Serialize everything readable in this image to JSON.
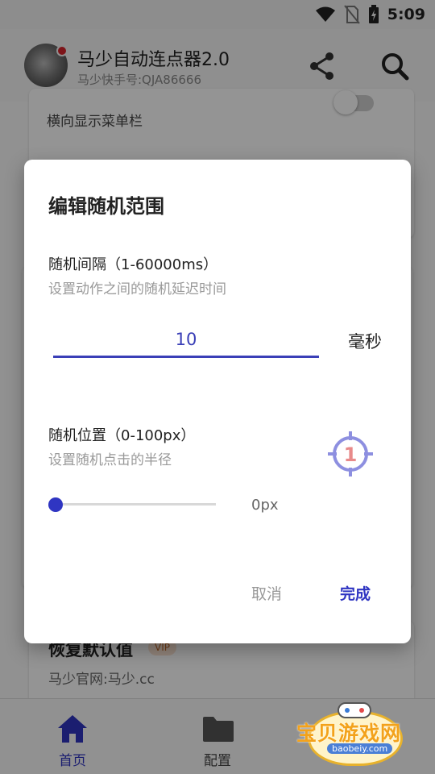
{
  "status_bar": {
    "time": "5:09",
    "icons": [
      "wifi-icon",
      "no-sim-icon",
      "battery-charging-icon"
    ]
  },
  "app_bar": {
    "title": "马少自动连点器2.0",
    "subtitle": "马少快手号:QJA86666",
    "actions": [
      "share-icon",
      "search-icon"
    ]
  },
  "background": {
    "horizontal_menu_label": "横向显示菜单栏",
    "restore_defaults_label": "恢复默认值",
    "vip_badge": "VIP",
    "official_site": "马少官网:马少.cc"
  },
  "dialog": {
    "title": "编辑随机范围",
    "interval": {
      "title": "随机间隔（1-60000ms）",
      "subtitle": "设置动作之间的随机延迟时间",
      "value": "10",
      "unit": "毫秒"
    },
    "position": {
      "title": "随机位置（0-100px）",
      "subtitle": "设置随机点击的半径",
      "value_label": "0px",
      "slider_fraction": 0,
      "target_number": "1"
    },
    "cancel_label": "取消",
    "done_label": "完成"
  },
  "bottom_nav": {
    "items": [
      {
        "label": "首页",
        "icon": "home-icon",
        "active": true
      },
      {
        "label": "配置",
        "icon": "folder-icon",
        "active": false
      }
    ]
  },
  "watermark": {
    "text": "宝贝游戏网",
    "url": "baobeiy.com"
  },
  "colors": {
    "accent": "#2f35c2",
    "target": "#8d8fe0",
    "target_number": "#e88a8a"
  }
}
